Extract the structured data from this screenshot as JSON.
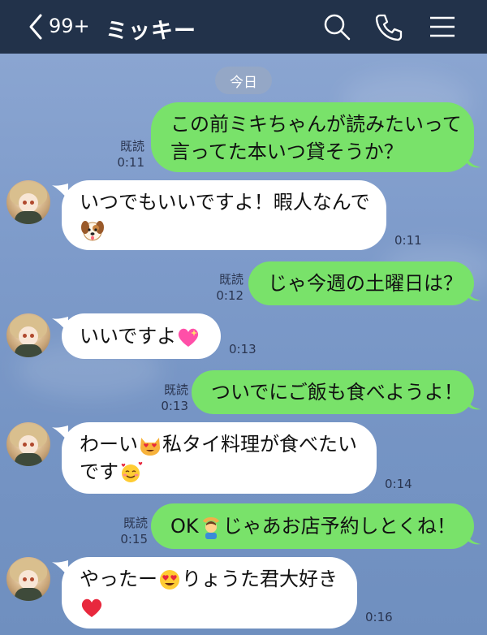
{
  "header": {
    "back_count": "99+",
    "title": "ミッキー",
    "icons": [
      "back-chevron-icon",
      "search-icon",
      "phone-icon",
      "menu-icon"
    ]
  },
  "date_label": "今日",
  "colors": {
    "header_bg": "#22324a",
    "outgoing": "#79e26a",
    "incoming": "#ffffff",
    "background": "#7b97c4"
  },
  "messages": [
    {
      "dir": "out",
      "lines": [
        "この前ミキちゃんが読みたいって",
        "言ってた本いつ貸そうか？"
      ],
      "read": "既読",
      "time": "0:11"
    },
    {
      "dir": "in",
      "lines": [
        "いつでもいいですよ！暇人なんで"
      ],
      "emoji": "dog-face-emoji",
      "time": "0:11"
    },
    {
      "dir": "out",
      "lines": [
        "じゃ今週の土曜日は？"
      ],
      "read": "既読",
      "time": "0:12"
    },
    {
      "dir": "in",
      "lines": [
        "いいですよ"
      ],
      "emoji": "sparkling-heart-emoji",
      "time": "0:13"
    },
    {
      "dir": "out",
      "lines": [
        "ついでにご飯も食べようよ！"
      ],
      "read": "既読",
      "time": "0:13"
    },
    {
      "dir": "in",
      "text_a": "わーい",
      "text_b": "私タイ料理が食べたい",
      "text_c": "です",
      "emojis": [
        "heart-eyes-cat-emoji",
        "smiling-face-with-hearts-emoji"
      ],
      "time": "0:14"
    },
    {
      "dir": "out",
      "text_a": "OK",
      "text_b": "じゃあお店予約しとくね！",
      "emoji": "person-gesturing-ok-emoji",
      "read": "既読",
      "time": "0:15"
    },
    {
      "dir": "in",
      "text_a": "やったー",
      "text_b": "りょうた君大好き",
      "emojis": [
        "heart-eyes-emoji",
        "red-heart-emoji"
      ],
      "time": "0:16"
    }
  ]
}
